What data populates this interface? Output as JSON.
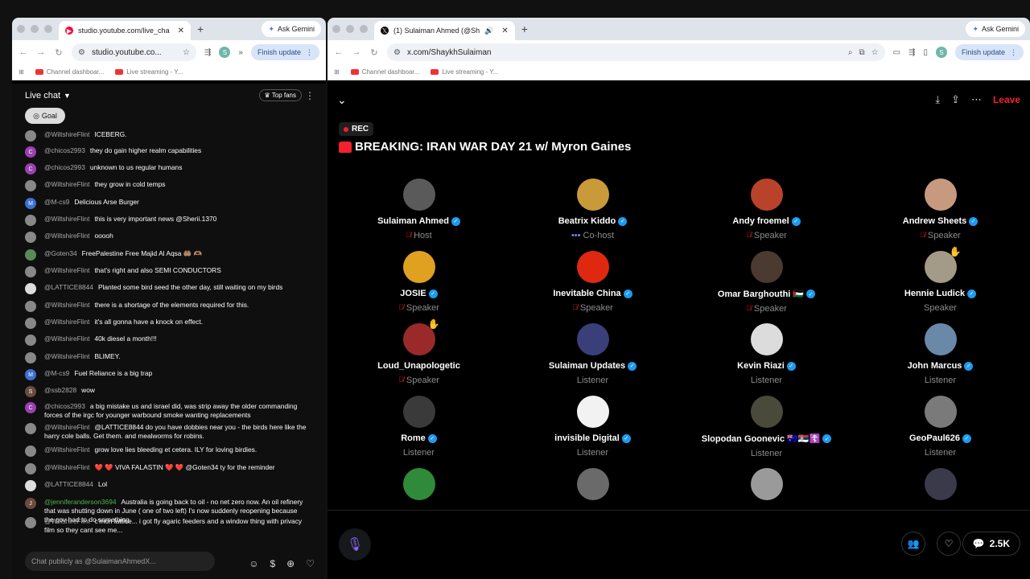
{
  "left_browser": {
    "tab_title": "studio.youtube.com/live_cha",
    "url": "studio.youtube.co...",
    "ask_gemini": "Ask Gemini",
    "finish_update": "Finish update",
    "profile_letter": "S",
    "bookmarks": [
      "Channel dashboar...",
      "Live streaming - Y..."
    ]
  },
  "chat": {
    "title": "Live chat",
    "top_fans": "Top fans",
    "goal": "Goal",
    "input_placeholder": "Chat publicly as @SulaimanAhmedX...",
    "messages": [
      {
        "author": "@WiltshireFlint",
        "text": "ICEBERG.",
        "avatar": "",
        "color": "#888"
      },
      {
        "author": "@chicos2993",
        "text": "they do gain higher realm capabilities",
        "avatar": "C",
        "color": "#9c3fb3"
      },
      {
        "author": "@chicos2993",
        "text": "unknown to us regular humans",
        "avatar": "C",
        "color": "#9c3fb3"
      },
      {
        "author": "@WiltshireFlint",
        "text": "they grow in cold temps",
        "avatar": "",
        "color": "#888"
      },
      {
        "author": "@M-cs9",
        "text": "Delicious Arse Burger",
        "avatar": "M",
        "color": "#3d6fd1"
      },
      {
        "author": "@WiltshireFlint",
        "text": "this is very important news @Sherii.1370",
        "avatar": "",
        "color": "#888"
      },
      {
        "author": "@WiltshireFlint",
        "text": "ooooh",
        "avatar": "",
        "color": "#888"
      },
      {
        "author": "@Goten34",
        "text": "FreePalestine Free Majid Al Aqsa 🤲🏽 🫶🏽",
        "avatar": "",
        "color": "#5a8a5a"
      },
      {
        "author": "@WiltshireFlint",
        "text": "that's right and also SEMI CONDUCTORS",
        "avatar": "",
        "color": "#888"
      },
      {
        "author": "@LATTICE8844",
        "text": "Planted some bird seed the other day, still waiting on my birds",
        "avatar": "",
        "color": "#ddd"
      },
      {
        "author": "@WiltshireFlint",
        "text": "there is a shortage of the elements required for this.",
        "avatar": "",
        "color": "#888"
      },
      {
        "author": "@WiltshireFlint",
        "text": "it's all gonna have a knock on effect.",
        "avatar": "",
        "color": "#888"
      },
      {
        "author": "@WiltshireFlint",
        "text": "40k diesel a month!!!",
        "avatar": "",
        "color": "#888"
      },
      {
        "author": "@WiltshireFlint",
        "text": "BLIMEY.",
        "avatar": "",
        "color": "#888"
      },
      {
        "author": "@M-cs9",
        "text": "Fuel Reliance is a big trap",
        "avatar": "M",
        "color": "#3d6fd1"
      },
      {
        "author": "@ssb2828",
        "text": "wow",
        "avatar": "S",
        "color": "#6b4b3e"
      },
      {
        "author": "@chicos2993",
        "text": "a big mistake us and israel did, was strip away the older commanding forces of the irgc for younger warbound smoke wanting replacements",
        "avatar": "C",
        "color": "#9c3fb3"
      },
      {
        "author": "@WiltshireFlint",
        "text": "@LATTICE8844 do you have dobbies near you - the birds here like the harry cole balls. Get them. and mealworms for robins.",
        "avatar": "",
        "color": "#888"
      },
      {
        "author": "@WiltshireFlint",
        "text": "grow love lies bleeding et cetera. ILY for loving birdies.",
        "avatar": "",
        "color": "#888"
      },
      {
        "author": "@WiltshireFlint",
        "text": "❤️ ❤️ VIVA FALASTIN ❤️ ❤️ @Goten34 ty for the reminder",
        "avatar": "",
        "color": "#888"
      },
      {
        "author": "@LATTICE8844",
        "text": "Lol",
        "avatar": "",
        "color": "#ddd"
      },
      {
        "author": "@jenniferanderson3694",
        "text": "Australia is going back to oil - no net zero now. An oil refinery that was shutting down in June ( one of two left) I's now suddenly reopening because the gov had to do something",
        "avatar": "J",
        "color": "#6b4b3e"
      },
      {
        "author": "@WiltshireFlint",
        "text": "c'mon lattice... i got fly agaric feeders and a window thing with privacy film so they cant see me...",
        "avatar": "",
        "color": "#888"
      }
    ]
  },
  "right_browser": {
    "tab_title": "(1) Sulaiman Ahmed (@Sh",
    "url": "x.com/ShaykhSulaiman",
    "ask_gemini": "Ask Gemini",
    "finish_update": "Finish update",
    "profile_letter": "S",
    "bookmarks": [
      "Channel dashboar...",
      "Live streaming - Y..."
    ]
  },
  "space": {
    "leave": "Leave",
    "rec": "REC",
    "title": "BREAKING: IRAN WAR DAY 21 w/ Myron Gaines",
    "listener_count": "2.5K",
    "participants": [
      {
        "name": "Sulaiman Ahmed",
        "role": "Host",
        "muted": true,
        "verified": true,
        "color": "#5a5a5a"
      },
      {
        "name": "Beatrix Kiddo",
        "role": "Co-host",
        "muted": false,
        "verified": true,
        "color": "#c99a3a"
      },
      {
        "name": "Andy froemel",
        "role": "Speaker",
        "muted": true,
        "verified": true,
        "color": "#b8432a"
      },
      {
        "name": "Andrew Sheets",
        "role": "Speaker",
        "muted": true,
        "verified": true,
        "color": "#c79a80"
      },
      {
        "name": "JOSIE",
        "role": "Speaker",
        "muted": true,
        "verified": true,
        "color": "#e0a020"
      },
      {
        "name": "Inevitable China",
        "role": "Speaker",
        "muted": true,
        "verified": true,
        "color": "#de2910"
      },
      {
        "name": "Omar Barghouthi 🇵🇸",
        "role": "Speaker",
        "muted": true,
        "verified": true,
        "color": "#4a3a30"
      },
      {
        "name": "Hennie Ludick",
        "role": "Speaker",
        "muted": false,
        "verified": true,
        "color": "#a49a88"
      },
      {
        "name": "Loud_Unapologetic",
        "role": "Speaker",
        "muted": true,
        "verified": false,
        "color": "#9a2a2a"
      },
      {
        "name": "Sulaiman Updates",
        "role": "Listener",
        "muted": false,
        "verified": true,
        "color": "#3a3f7a"
      },
      {
        "name": "Kevin Riazi",
        "role": "Listener",
        "muted": false,
        "verified": true,
        "color": "#dcdcdc"
      },
      {
        "name": "John Marcus",
        "role": "Listener",
        "muted": false,
        "verified": true,
        "color": "#6a88a8"
      },
      {
        "name": "Rome",
        "role": "Listener",
        "muted": false,
        "verified": true,
        "color": "#3a3a3a"
      },
      {
        "name": "invisible Digital",
        "role": "Listener",
        "muted": false,
        "verified": true,
        "color": "#f2f2f2"
      },
      {
        "name": "Slopodan Goonevic 🇦🇺🇷🇸☦️",
        "role": "Listener",
        "muted": false,
        "verified": true,
        "color": "#4a4a3a"
      },
      {
        "name": "GeoPaul626",
        "role": "Listener",
        "muted": false,
        "verified": true,
        "color": "#7a7a7a"
      },
      {
        "name": "",
        "role": "",
        "muted": false,
        "verified": false,
        "color": "#2f8a3a"
      },
      {
        "name": "",
        "role": "",
        "muted": false,
        "verified": false,
        "color": "#6a6a6a"
      },
      {
        "name": "",
        "role": "",
        "muted": false,
        "verified": false,
        "color": "#9a9a9a"
      },
      {
        "name": "",
        "role": "",
        "muted": false,
        "verified": false,
        "color": "#3a3a4a"
      }
    ]
  }
}
